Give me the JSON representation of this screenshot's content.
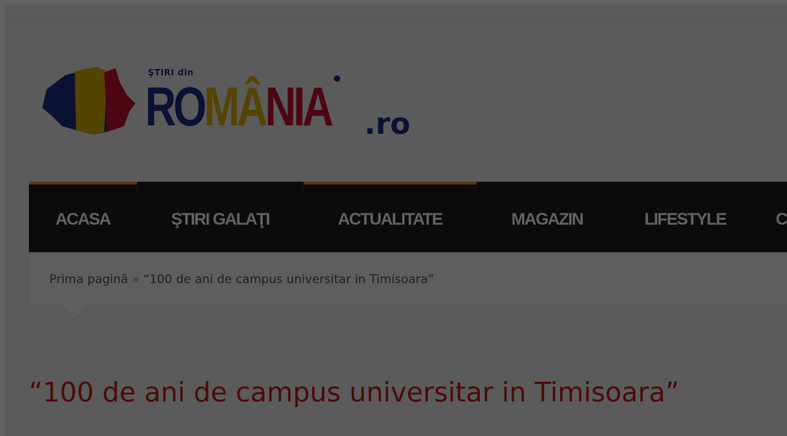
{
  "logo": {
    "small_text": "ŞTIRI din",
    "word_part1": "RO",
    "word_part2": "MÂ",
    "word_part3": "NIA",
    "tld": ".ro"
  },
  "nav": {
    "items": [
      {
        "label": "ACASA",
        "active": true
      },
      {
        "label": "ŞTIRI GALAŢI",
        "active": false
      },
      {
        "label": "ACTUALITATE",
        "active": true
      },
      {
        "label": "MAGAZIN",
        "active": false
      },
      {
        "label": "LIFESTYLE",
        "active": false
      },
      {
        "label": "C",
        "active": false
      }
    ],
    "accent_color": "#f29423"
  },
  "breadcrumb": {
    "home": "Prima pagină",
    "separator": "»",
    "current": "“100 de ani de campus universitar in Timisoara”"
  },
  "article": {
    "title": "“100 de ani de campus universitar in Timisoara”",
    "title_color": "#c41f16"
  }
}
